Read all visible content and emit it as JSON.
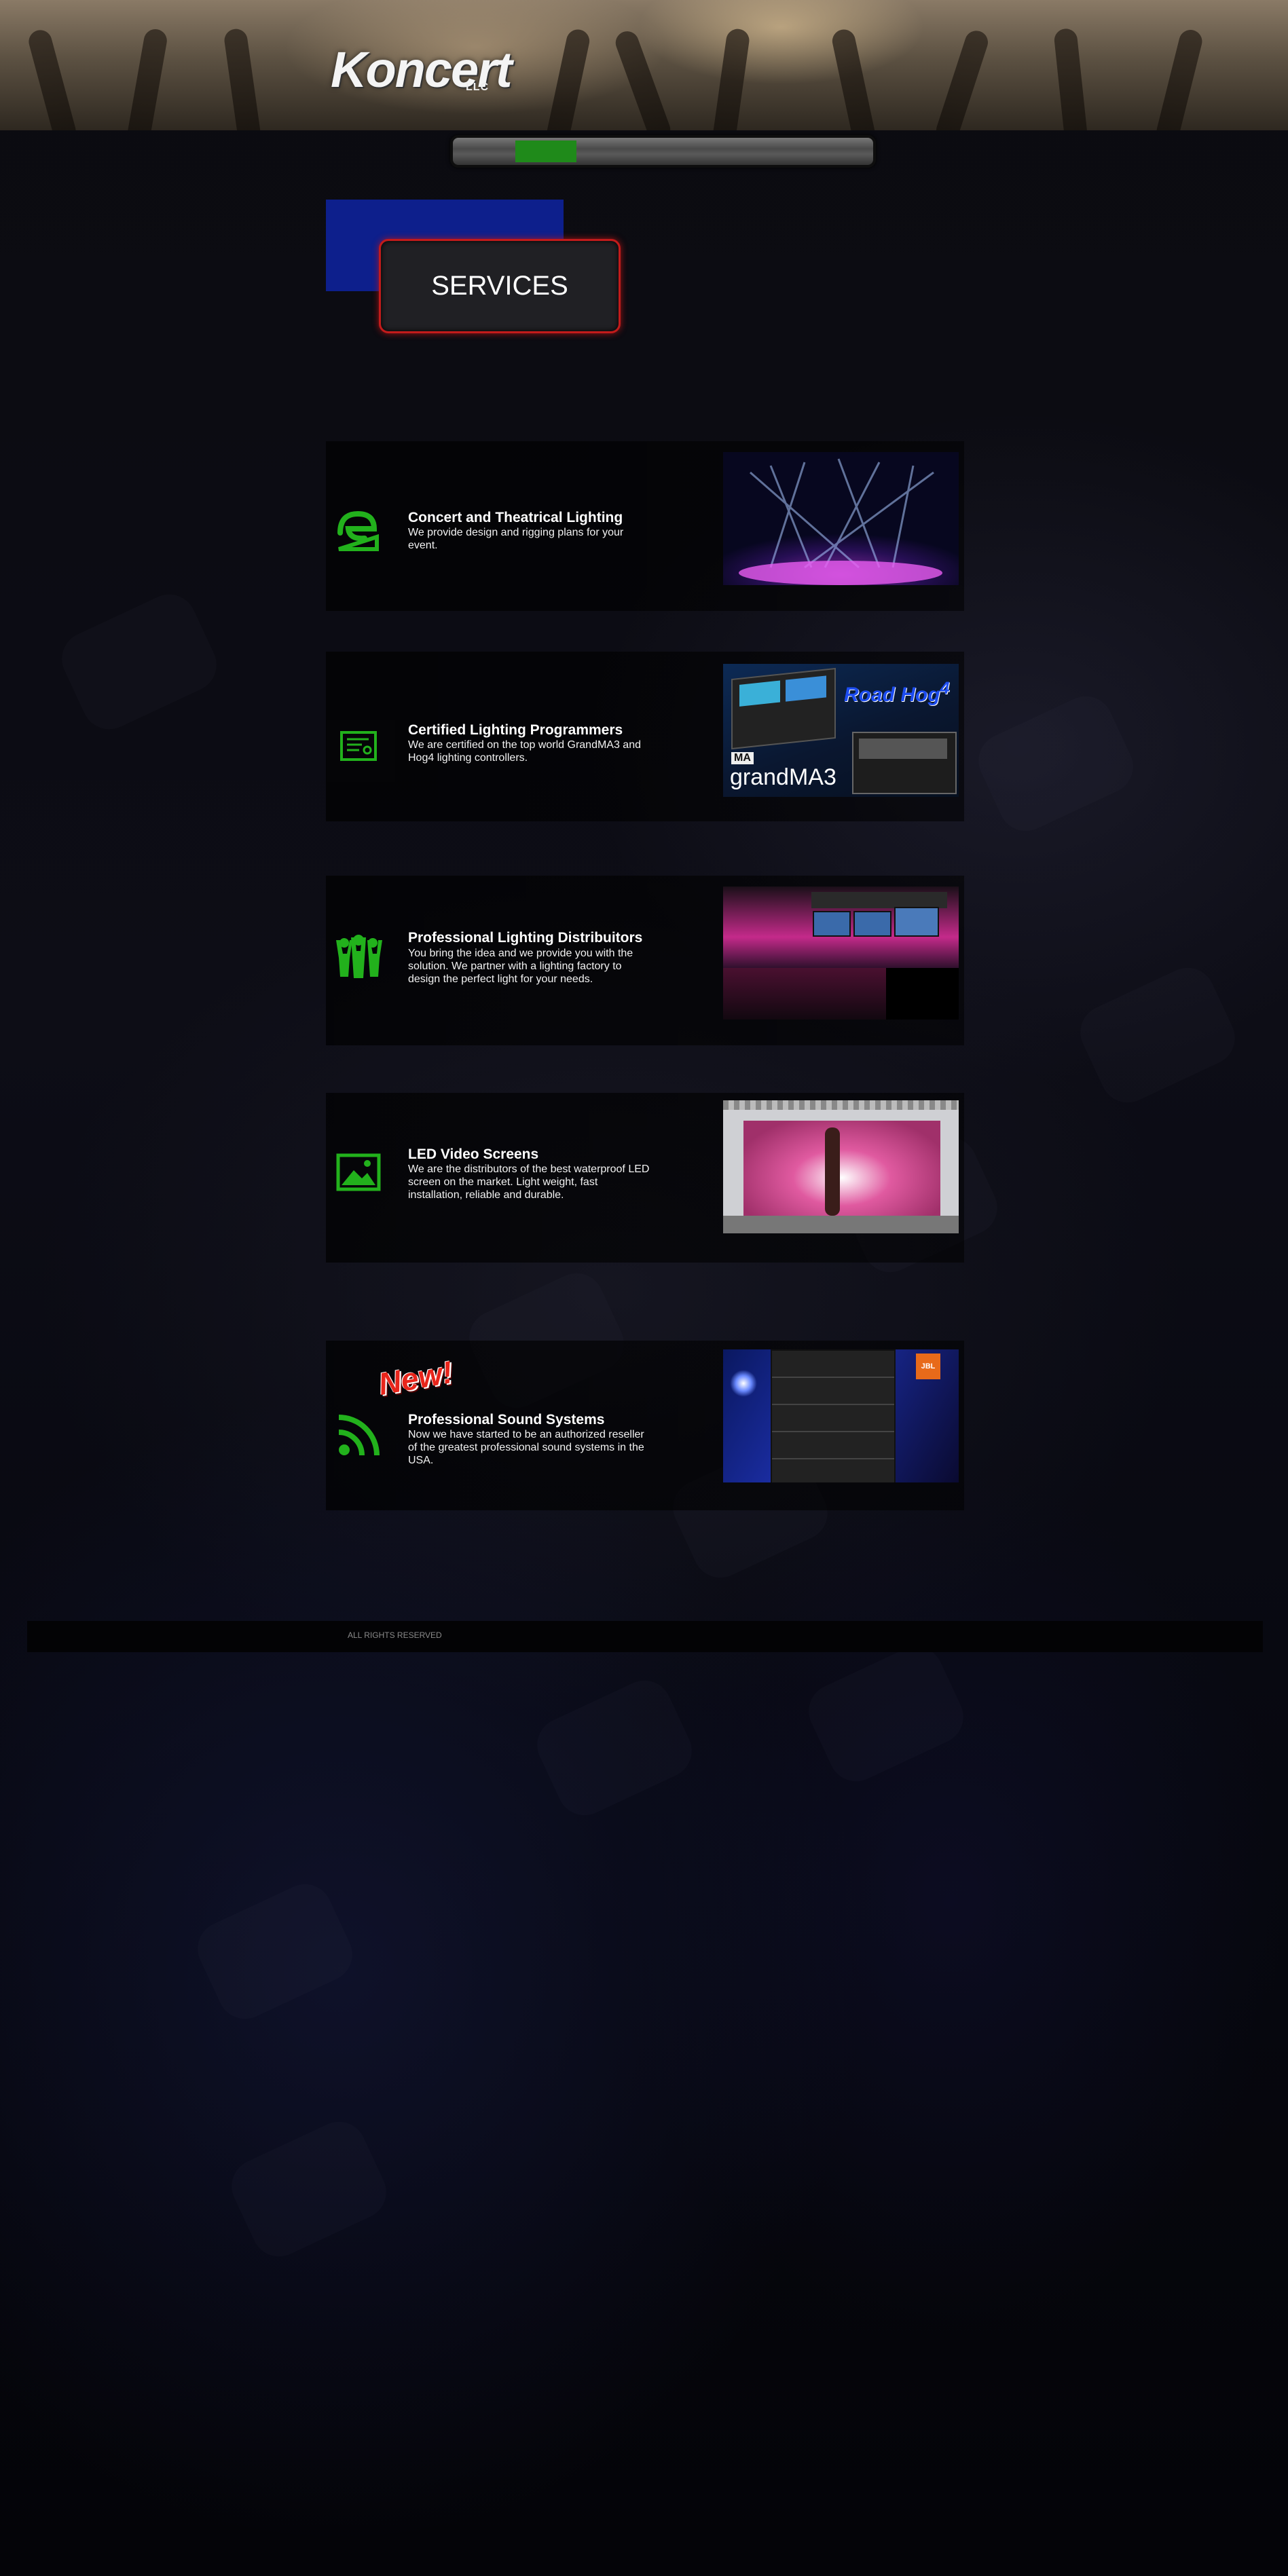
{
  "brand": {
    "logo_text": "Koncert",
    "logo_sub": "LLC"
  },
  "nav": {
    "active_index": 1,
    "item_count": 6
  },
  "page": {
    "section_heading": "SERVICES"
  },
  "services": [
    {
      "title": "Concert and Theatrical Lighting",
      "description": "We provide design and rigging plans for your event.",
      "icon": "ruler-pencil-icon"
    },
    {
      "title": "Certified Lighting Programmers",
      "description": "We are certified on the top world GrandMA3 and Hog4 lighting controllers.",
      "icon": "certificate-icon"
    },
    {
      "title": "Professional Lighting Distribuitors",
      "description": "You bring the idea and we provide you with the solution. We partner with a lighting factory to design the perfect light for your needs.",
      "icon": "team-icon"
    },
    {
      "title": "LED Video Screens",
      "description": "We are the distributors of the best waterproof LED screen on the market. Light weight, fast installation, reliable and durable.",
      "icon": "image-icon"
    },
    {
      "title": "Professional Sound Systems",
      "description": "Now we have started to be an authorized reseller of the greatest professional sound systems in the USA.",
      "icon": "rss-icon"
    }
  ],
  "badges": {
    "new_label": "New!"
  },
  "photos": {
    "controllers": {
      "road_hog": "Road Hog",
      "road_hog_num": "4",
      "ma_logo": "MA",
      "grandma": "grandMA3"
    },
    "sound": {
      "jbl": "JBL"
    }
  },
  "footer": {
    "copyright": "ALL RIGHTS RESERVED"
  },
  "colors": {
    "accent_green": "#22b11c",
    "services_border": "#c21b1b",
    "blue_block": "#0d1f8c"
  }
}
